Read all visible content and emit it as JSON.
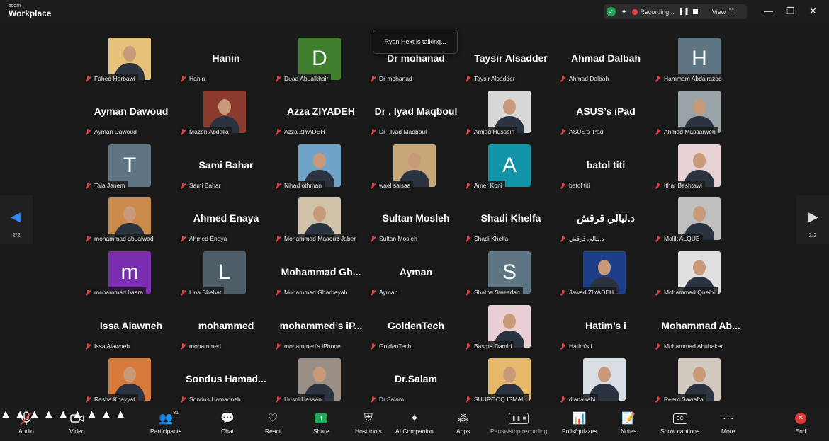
{
  "app": {
    "logo_small": "zoom",
    "logo_big": "Workplace"
  },
  "recording": {
    "text": "Recording...",
    "view_label": "View"
  },
  "window_controls": {
    "minimize": "—",
    "restore": "❐",
    "close": "✕"
  },
  "toast": "Ryan Hext is talking...",
  "page_indicator": "2/2",
  "colors": {
    "green_avatar": "#3f7f2e",
    "gray_avatar": "#5e7583",
    "teal_avatar": "#1193a8",
    "purple_avatar": "#7b2fb0",
    "slate_avatar": "#4d5e68",
    "end_red": "#d93838",
    "share_green": "#23a55a"
  },
  "participants": [
    {
      "label": "Fahed Herbawi",
      "kind": "photo",
      "tone": "#e6c27a"
    },
    {
      "label": "Hanin",
      "kind": "name",
      "display": "Hanin"
    },
    {
      "label": "Duaa Abualkhair",
      "kind": "letter",
      "letter": "D",
      "color": "#3f7f2e"
    },
    {
      "label": "Dr mohanad",
      "kind": "name",
      "display": "Dr mohanad"
    },
    {
      "label": "Taysir Alsadder",
      "kind": "name",
      "display": "Taysir Alsadder"
    },
    {
      "label": "Ahmad Dalbah",
      "kind": "name",
      "display": "Ahmad Dalbah"
    },
    {
      "label": "Hammam Abdalrazeq",
      "kind": "letter",
      "letter": "H",
      "color": "#5e7583"
    },
    {
      "label": "Ayman Dawoud",
      "kind": "name",
      "display": "Ayman Dawoud"
    },
    {
      "label": "Mazen Abdalla",
      "kind": "photo",
      "tone": "#8a3b2e"
    },
    {
      "label": "Azza ZIYADEH",
      "kind": "name",
      "display": "Azza ZIYADEH"
    },
    {
      "label": "Dr . Iyad Maqboul",
      "kind": "name",
      "display": "Dr . Iyad Maqboul"
    },
    {
      "label": "Amjad Hussein",
      "kind": "photo",
      "tone": "#d8d8d8"
    },
    {
      "label": "ASUS’s iPad",
      "kind": "name",
      "display": "ASUS’s iPad"
    },
    {
      "label": "Ahmad Massarweh",
      "kind": "photo",
      "tone": "#9aa3a8"
    },
    {
      "label": "Tala Janem",
      "kind": "letter",
      "letter": "T",
      "color": "#5e7583"
    },
    {
      "label": "Sami Bahar",
      "kind": "name",
      "display": "Sami Bahar"
    },
    {
      "label": "Nihad othman",
      "kind": "photo",
      "tone": "#6fa3c8"
    },
    {
      "label": "wael salsaa",
      "kind": "photo",
      "tone": "#c9a677"
    },
    {
      "label": "Amer Koni",
      "kind": "letter",
      "letter": "A",
      "color": "#1193a8"
    },
    {
      "label": "batol titi",
      "kind": "name",
      "display": "batol titi"
    },
    {
      "label": "Ithar Beshtawi",
      "kind": "photo",
      "tone": "#e8d2d6"
    },
    {
      "label": "mohammad abualwad",
      "kind": "photo",
      "tone": "#c98a4a"
    },
    {
      "label": "Ahmed Enaya",
      "kind": "name",
      "display": "Ahmed Enaya"
    },
    {
      "label": "Mohammad Maaouz Jaber",
      "kind": "photo",
      "tone": "#cfc2a8"
    },
    {
      "label": "Sultan Mosleh",
      "kind": "name",
      "display": "Sultan Mosleh"
    },
    {
      "label": "Shadi Khelfa",
      "kind": "name",
      "display": "Shadi Khelfa"
    },
    {
      "label": "د.ليالي قرقش",
      "kind": "name",
      "display": "د.ليالي قرقش"
    },
    {
      "label": "Malik ALQUB",
      "kind": "photo",
      "tone": "#bfbfbf"
    },
    {
      "label": "mohammad baara",
      "kind": "letter",
      "letter": "m",
      "color": "#7b2fb0"
    },
    {
      "label": "Lina Sbehat",
      "kind": "letter",
      "letter": "L",
      "color": "#4d5e68"
    },
    {
      "label": "Mohammad Gharbeyah",
      "kind": "name",
      "display": "Mohammad Gh..."
    },
    {
      "label": "Ayman",
      "kind": "name",
      "display": "Ayman"
    },
    {
      "label": "Shatha Sweedan",
      "kind": "letter",
      "letter": "S",
      "color": "#5e7583"
    },
    {
      "label": "Jawad ZIYADEH",
      "kind": "photo",
      "tone": "#1d3f8a"
    },
    {
      "label": "Mohammad Qneibi",
      "kind": "photo",
      "tone": "#e0e0e0"
    },
    {
      "label": "Issa Alawneh",
      "kind": "name",
      "display": "Issa Alawneh"
    },
    {
      "label": "mohammed",
      "kind": "name",
      "display": "mohammed"
    },
    {
      "label": "mohammed’s iPhone",
      "kind": "name",
      "display": "mohammed’s iP..."
    },
    {
      "label": "GoldenTech",
      "kind": "name",
      "display": "GoldenTech"
    },
    {
      "label": "Basma Damiri",
      "kind": "photo",
      "tone": "#e9cfd4"
    },
    {
      "label": "Hatim’s i",
      "kind": "name",
      "display": "Hatim’s i"
    },
    {
      "label": "Mohammad Abubaker",
      "kind": "name",
      "display": "Mohammad Ab..."
    },
    {
      "label": "Rasha Khayyat",
      "kind": "photo",
      "tone": "#d87a3a"
    },
    {
      "label": "Sondus Hamadneh",
      "kind": "name",
      "display": "Sondus Hamad..."
    },
    {
      "label": "Husni Hassan",
      "kind": "photo",
      "tone": "#9a8f86"
    },
    {
      "label": "Dr.Salam",
      "kind": "name",
      "display": "Dr.Salam"
    },
    {
      "label": "SHUROOQ ISMAIL",
      "kind": "photo",
      "tone": "#e6b86a"
    },
    {
      "label": "diana rabi",
      "kind": "photo",
      "tone": "#d9dee4"
    },
    {
      "label": "Reem Sawafta",
      "kind": "photo",
      "tone": "#d2c9c0"
    }
  ],
  "toolbar": {
    "audio": "Audio",
    "video": "Video",
    "participants": "Participants",
    "participants_count": "81",
    "chat": "Chat",
    "react": "React",
    "share": "Share",
    "host_tools": "Host tools",
    "ai_companion": "AI Companion",
    "apps": "Apps",
    "pause_stop": "Pause/stop recording",
    "polls": "Polls/quizzes",
    "notes": "Notes",
    "captions": "Show captions",
    "more": "More",
    "end": "End"
  }
}
